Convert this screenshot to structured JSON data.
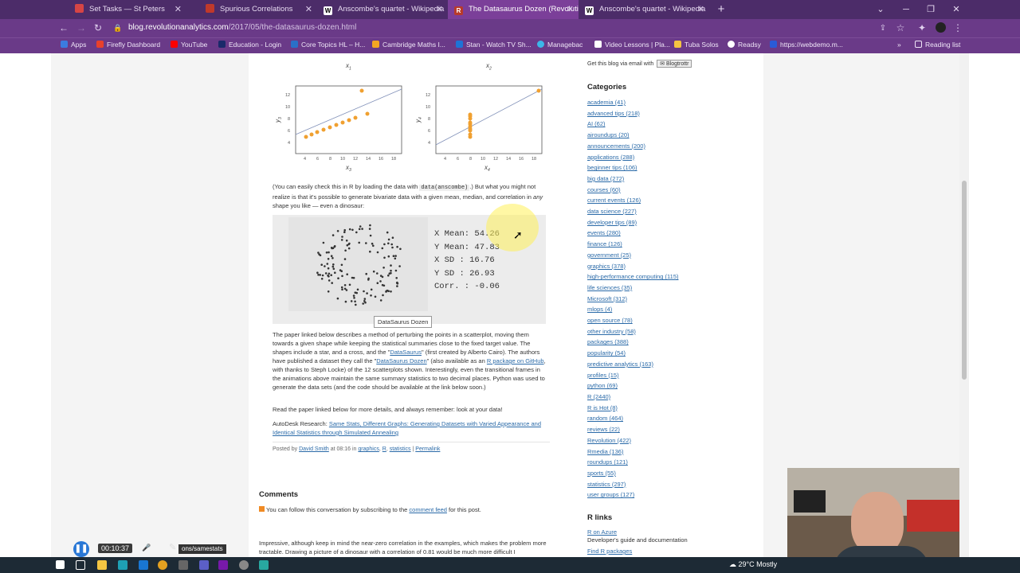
{
  "tabs": [
    {
      "title": "Set Tasks — St Peters",
      "color": "#d64545",
      "active": false
    },
    {
      "title": "Spurious Correlations",
      "color": "#c0392b",
      "active": false
    },
    {
      "title": "Anscombe's quartet - Wikipedia",
      "color": "#ffffff",
      "active": false
    },
    {
      "title": "The Datasaurus Dozen (Revolutio",
      "color": "#b83a2a",
      "active": true
    },
    {
      "title": "Anscombe's quartet - Wikipedia",
      "color": "#ffffff",
      "active": false
    }
  ],
  "url": {
    "host": "blog.revolutionanalytics.com",
    "path": "/2017/05/the-datasaurus-dozen.html"
  },
  "bookmarks": [
    "Apps",
    "Firefly Dashboard",
    "YouTube",
    "Education - Login",
    "Core Topics HL – H...",
    "Cambridge Maths I...",
    "Stan - Watch TV Sh...",
    "Managebac",
    "Video Lessons | Pla...",
    "Tuba Solos",
    "Readsy",
    "https://webdemo.m..."
  ],
  "reading_list": "Reading list",
  "plots": {
    "top_axis_labels": [
      "x",
      "x"
    ],
    "plot3": {
      "ylabel": "y",
      "xlabel": "x",
      "ylabel_sub": "3",
      "xlabel_sub": "3"
    },
    "plot4": {
      "ylabel": "y",
      "xlabel": "x",
      "ylabel_sub": "4",
      "xlabel_sub": "4"
    },
    "top_axis_subs": [
      "1",
      "2"
    ],
    "ticks_x": [
      "4",
      "6",
      "8",
      "10",
      "12",
      "14",
      "16",
      "18"
    ],
    "ticks_y": [
      "4",
      "6",
      "8",
      "10",
      "12"
    ]
  },
  "article": {
    "p1_a": "(You can easily check this in R by loading the data with ",
    "p1_code": "data(anscombe)",
    "p1_b": ".) But what you might not realize is that it's possible to generate bivariate data with a given mean, median, and correlation in ",
    "p1_em": "any",
    "p1_c": " shape you like — even a dinosaur:",
    "anim_caption": "DataSaurus Dozen",
    "stats": [
      {
        "label": "X Mean:",
        "value": "54.26"
      },
      {
        "label": "Y Mean:",
        "value": "47.83"
      },
      {
        "label": "X SD  :",
        "value": "16.76"
      },
      {
        "label": "Y SD  :",
        "value": "26.93"
      },
      {
        "label": "Corr. :",
        "value": "-0.06"
      }
    ],
    "p2_a": "The paper linked below describes a method of perturbing the points in a scatterplot, moving them towards a given shape while keeping the statistical summaries close to the fixed target value. The shapes include a star, and a cross, and the \"",
    "p2_link1": "DataSaurus",
    "p2_b": "\" (first created by Alberto Cairo). The authors have published a dataset they call the \"",
    "p2_link2": "DataSaurus Dozen",
    "p2_c": "\" (also available as an ",
    "p2_link3": "R package on GitHub",
    "p2_d": ", with thanks to Steph Locke) of the 12 scatterplots shown. Interestingly, even the transitional frames in the animations above maintain the same summary statistics to two decimal places. Python was used to generate the data sets (and the code should be available at the link below soon.)",
    "p3": "Read the paper linked below for more details, and always remember: look at your data!",
    "p4_a": "AutoDesk Research: ",
    "p4_link": "Same Stats, Different Graphs: Generating Datasets with Varied Appearance and Identical Statistics through Simulated Annealing",
    "posted_a": "Posted by ",
    "posted_author": "David Smith",
    "posted_b": " at 08:16 in ",
    "posted_c1": "graphics",
    "posted_c2": "R",
    "posted_c3": "statistics",
    "posted_sep": " | ",
    "posted_perma": "Permalink",
    "comments_title": "Comments",
    "comments_feed_a": "You can follow this conversation by subscribing to the ",
    "comments_feed_link": "comment feed",
    "comments_feed_b": " for this post.",
    "comment_text": "Impressive, although keep in mind the near-zero correlation in the examples, which makes the problem more tractable. Drawing a picture of a dinosaur with a correlation of 0.81 would be much more difficult I"
  },
  "sidebar": {
    "email_text": "Get this blog via email with",
    "blogtrottr": "Blogtrottr",
    "categories_title": "Categories",
    "categories": [
      "academia (41)",
      "advanced tips (218)",
      "AI (62)",
      "airoundups (20)",
      "announcements (200)",
      "applications (288)",
      "beginner tips (106)",
      "big data (272)",
      "courses (60)",
      "current events (126)",
      "data science (227)",
      "developer tips (89)",
      "events (280)",
      "finance (126)",
      "government (25)",
      "graphics (378)",
      "high-performance computing (115)",
      "life sciences (35)",
      "Microsoft (312)",
      "mlops (4)",
      "open source (78)",
      "other industry (58)",
      "packages (388)",
      "popularity (54)",
      "predictive analytics (163)",
      "profiles (15)",
      "python (69)",
      "R (2440)",
      "R is Hot (8)",
      "random (464)",
      "reviews (22)",
      "Revolution (422)",
      "Rmedia (136)",
      "roundups (121)",
      "sports (55)",
      "statistics (297)",
      "user groups (127)"
    ],
    "rlinks_title": "R links",
    "rlinks": [
      "R on Azure",
      "Developer's guide and documentation",
      "Find R packages"
    ]
  },
  "recorder": {
    "time": "00:10:37",
    "status_text": "ons/samestats"
  },
  "taskbar": {
    "weather": "29°C",
    "weather_text": "Mostly"
  }
}
